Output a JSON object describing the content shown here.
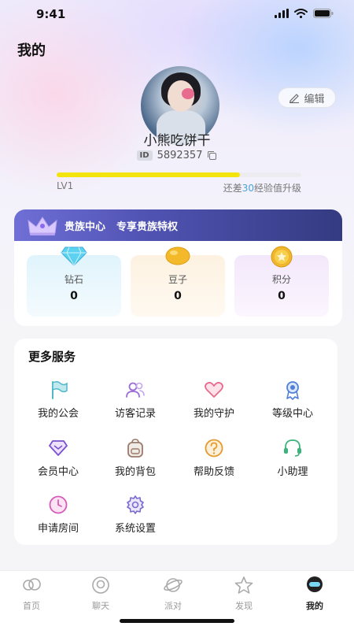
{
  "status": {
    "time": "9:41"
  },
  "header": {
    "title": "我的"
  },
  "profile": {
    "edit_label": "编辑",
    "username": "小熊吃饼干",
    "id_badge": "ID",
    "id": "5892357",
    "level": "LV1",
    "exp_prefix": "还差",
    "exp_needed": "30",
    "exp_suffix": "经验值升级",
    "exp_progress": 0.75
  },
  "vip": {
    "title": "贵族中心",
    "subtitle": "专享贵族特权",
    "items": [
      {
        "label": "钻石",
        "value": "0",
        "icon": "diamond-icon"
      },
      {
        "label": "豆子",
        "value": "0",
        "icon": "bean-icon"
      },
      {
        "label": "积分",
        "value": "0",
        "icon": "points-coin-icon"
      }
    ]
  },
  "services": {
    "title": "更多服务",
    "items": [
      {
        "label": "我的公会",
        "icon": "flag-icon",
        "color": "#52b7c9"
      },
      {
        "label": "访客记录",
        "icon": "visitors-icon",
        "color": "#9b6cd6"
      },
      {
        "label": "我的守护",
        "icon": "heart-icon",
        "color": "#e86a8b"
      },
      {
        "label": "等级中心",
        "icon": "medal-icon",
        "color": "#4f7fd6"
      },
      {
        "label": "会员中心",
        "icon": "vip-diamond-icon",
        "color": "#7a4fd0"
      },
      {
        "label": "我的背包",
        "icon": "backpack-icon",
        "color": "#9a7a6a"
      },
      {
        "label": "帮助反馈",
        "icon": "help-icon",
        "color": "#e59a2c"
      },
      {
        "label": "小助理",
        "icon": "headset-icon",
        "color": "#3bb37a"
      },
      {
        "label": "申请房间",
        "icon": "clock-icon",
        "color": "#d65bb8"
      },
      {
        "label": "系统设置",
        "icon": "gear-icon",
        "color": "#7a6bd0"
      }
    ]
  },
  "tabbar": {
    "items": [
      {
        "label": "首页",
        "icon": "home-icon"
      },
      {
        "label": "聊天",
        "icon": "chat-icon"
      },
      {
        "label": "派对",
        "icon": "party-icon"
      },
      {
        "label": "发现",
        "icon": "discover-star-icon"
      },
      {
        "label": "我的",
        "icon": "profile-icon",
        "active": true
      }
    ]
  }
}
